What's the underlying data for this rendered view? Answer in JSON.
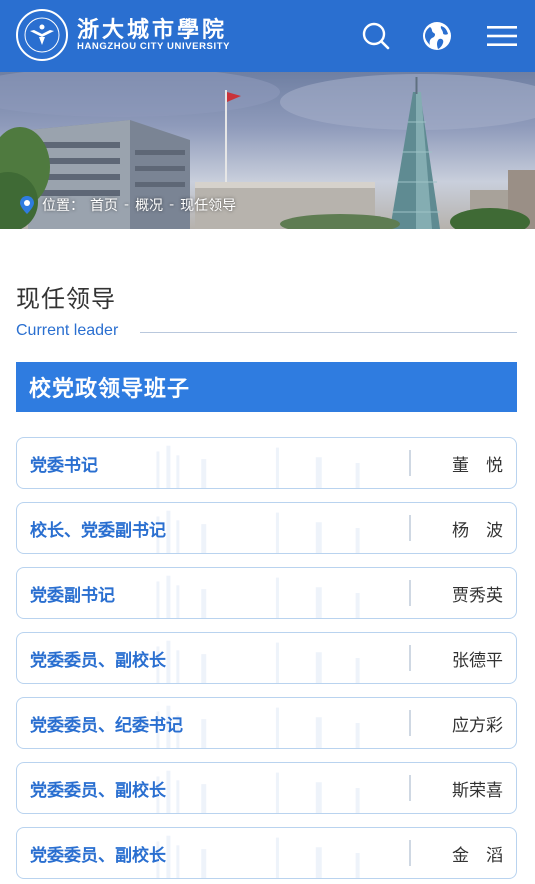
{
  "header": {
    "logo_zh": "浙大城市學院",
    "logo_en": "HANGZHOU CITY UNIVERSITY",
    "icons": [
      "search-icon",
      "globe-icon",
      "menu-icon"
    ],
    "brand_color": "#2a6fd0"
  },
  "breadcrumb": {
    "prefix": "位置：",
    "items": [
      "首页",
      "概况",
      "现任领导"
    ],
    "separator": "-"
  },
  "page": {
    "title": "现任领导",
    "subtitle": "Current leader"
  },
  "section": {
    "title": "校党政领导班子",
    "color": "#2f7ce0"
  },
  "leaders": [
    {
      "role": "党委书记",
      "name": "董　悦"
    },
    {
      "role": "校长、党委副书记",
      "name": "杨　波"
    },
    {
      "role": "党委副书记",
      "name": "贾秀英"
    },
    {
      "role": "党委委员、副校长",
      "name": "张德平"
    },
    {
      "role": "党委委员、纪委书记",
      "name": "应方彩"
    },
    {
      "role": "党委委员、副校长",
      "name": "斯荣喜"
    },
    {
      "role": "党委委员、副校长",
      "name": "金　滔"
    }
  ]
}
